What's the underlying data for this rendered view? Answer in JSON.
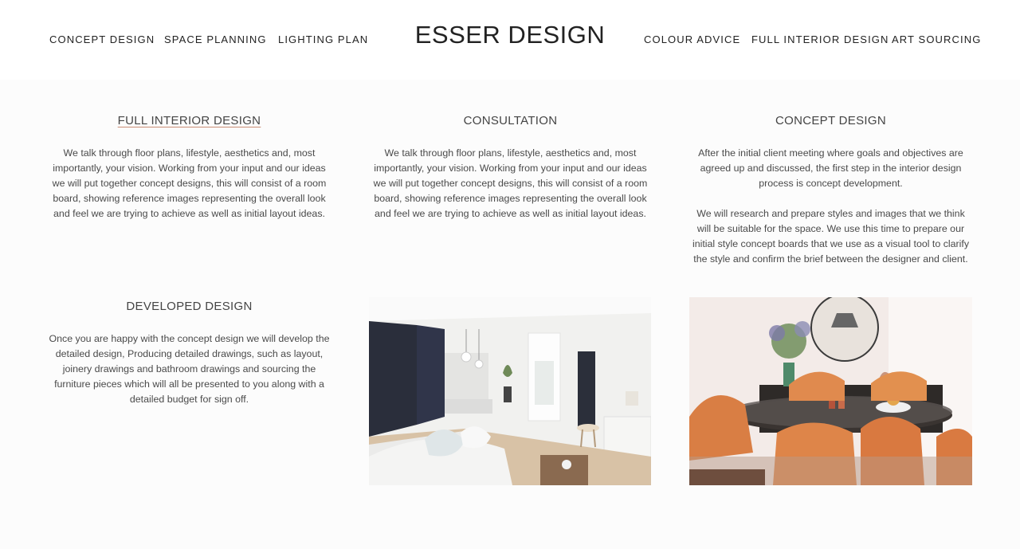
{
  "header": {
    "logo": "ESSER DESIGN",
    "nav_left": [
      "CONCEPT DESIGN",
      "SPACE PLANNING",
      "LIGHTING PLAN"
    ],
    "nav_right": [
      "COLOUR ADVICE",
      "FULL INTERIOR DESIGN",
      "ART SOURCING"
    ]
  },
  "sections": {
    "full_interior": {
      "title": "FULL INTERIOR DESIGN",
      "text": "We talk through floor plans, lifestyle, aesthetics and, most importantly, your vision. Working from your input and our ideas we will put together concept designs, this will consist of a room board, showing reference images representing the overall look and feel we are trying to achieve as well as initial layout ideas."
    },
    "consultation": {
      "title": "CONSULTATION",
      "text": "We talk through floor plans, lifestyle, aesthetics and, most importantly, your vision. Working from your input and our ideas we will put together concept designs, this will consist of a room board, showing reference images representing the overall look and feel we are trying to achieve as well as initial layout ideas."
    },
    "concept": {
      "title": "CONCEPT DESIGN",
      "text1": "After the initial client meeting where goals and objectives are agreed up and discussed, the first step in the interior design process is concept development.",
      "text2": "We will research and prepare styles and images that we think will be suitable for the space. We use this time to prepare our initial style concept boards that we use as a visual tool to clarify the style and confirm the brief between the designer and client."
    },
    "developed": {
      "title": "DEVELOPED DESIGN",
      "text": "Once you are happy with the concept design we will develop the detailed design, Producing detailed drawings, such as layout, joinery drawings and bathroom drawings and sourcing the furniture pieces which will all be presented to you along with a detailed budget for sign off."
    }
  },
  "colors": {
    "accent_underline": "#c98d75",
    "background": "#fcfcfc",
    "text": "#444444"
  }
}
